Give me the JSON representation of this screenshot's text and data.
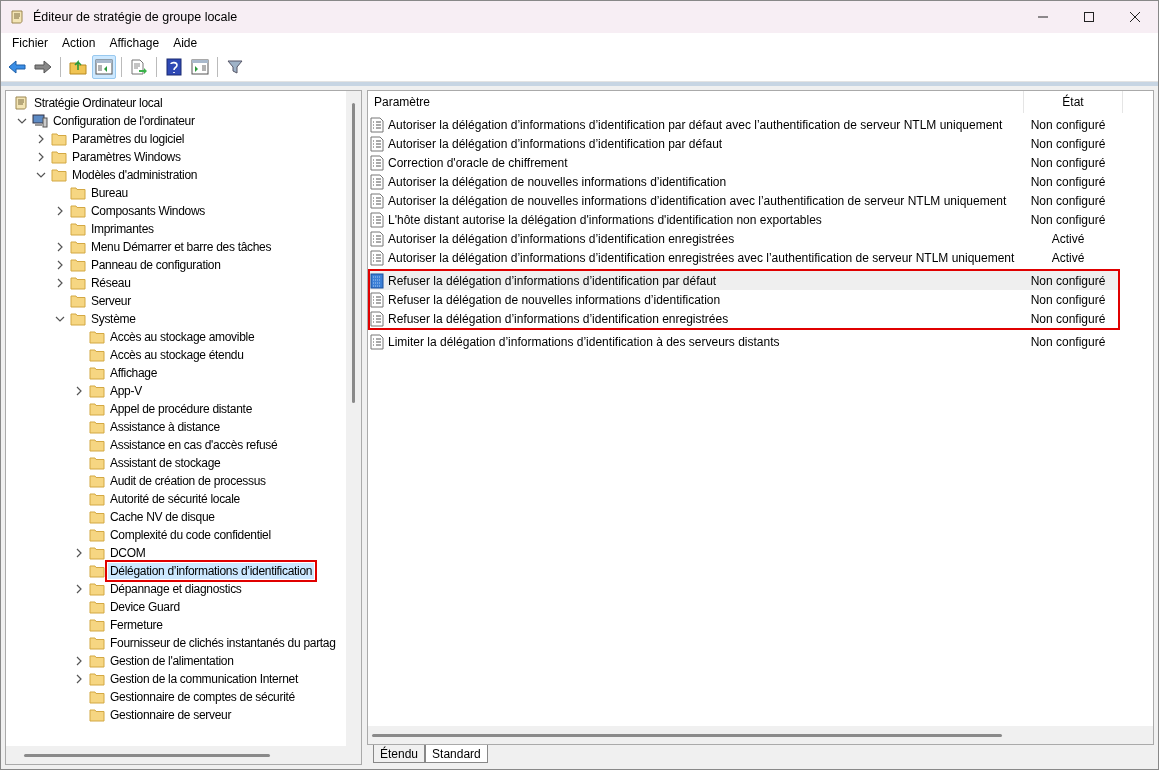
{
  "window": {
    "title": "Éditeur de stratégie de groupe locale"
  },
  "menu": [
    "Fichier",
    "Action",
    "Affichage",
    "Aide"
  ],
  "toolbar": [
    {
      "kind": "back",
      "pressed": false
    },
    {
      "kind": "forward",
      "pressed": false
    },
    {
      "kind": "up",
      "pressed": false
    },
    {
      "kind": "tree",
      "pressed": true
    },
    {
      "kind": "export",
      "pressed": false
    },
    {
      "kind": "help",
      "pressed": false
    },
    {
      "kind": "pane",
      "pressed": false
    },
    {
      "kind": "filter",
      "pressed": false
    }
  ],
  "tree": [
    {
      "label": "Stratégie Ordinateur local",
      "kind": "policy",
      "selected": false,
      "highlighted": false,
      "children": [
        {
          "label": "Configuration de l'ordinateur",
          "kind": "computer",
          "expanded": true,
          "selected": false,
          "highlighted": false,
          "children": [
            {
              "label": "Paramètres du logiciel",
              "kind": "folder",
              "expanded": false,
              "selected": false,
              "highlighted": false
            },
            {
              "label": "Paramètres Windows",
              "kind": "folder",
              "expanded": false,
              "selected": false,
              "highlighted": false
            },
            {
              "label": "Modèles d'administration",
              "kind": "folder",
              "expanded": true,
              "selected": false,
              "highlighted": false,
              "children": [
                {
                  "label": "Bureau",
                  "kind": "folder",
                  "selected": false,
                  "highlighted": false
                },
                {
                  "label": "Composants Windows",
                  "kind": "folder",
                  "expanded": false,
                  "selected": false,
                  "highlighted": false
                },
                {
                  "label": "Imprimantes",
                  "kind": "folder",
                  "selected": false,
                  "highlighted": false
                },
                {
                  "label": "Menu Démarrer et barre des tâches",
                  "kind": "folder",
                  "expanded": false,
                  "selected": false,
                  "highlighted": false
                },
                {
                  "label": "Panneau de configuration",
                  "kind": "folder",
                  "expanded": false,
                  "selected": false,
                  "highlighted": false
                },
                {
                  "label": "Réseau",
                  "kind": "folder",
                  "expanded": false,
                  "selected": false,
                  "highlighted": false
                },
                {
                  "label": "Serveur",
                  "kind": "folder",
                  "selected": false,
                  "highlighted": false
                },
                {
                  "label": "Système",
                  "kind": "folder",
                  "expanded": true,
                  "selected": false,
                  "highlighted": false,
                  "children": [
                    {
                      "label": "Accès au stockage amovible",
                      "kind": "folder",
                      "selected": false,
                      "highlighted": false
                    },
                    {
                      "label": "Accès au stockage étendu",
                      "kind": "folder",
                      "selected": false,
                      "highlighted": false
                    },
                    {
                      "label": "Affichage",
                      "kind": "folder",
                      "selected": false,
                      "highlighted": false
                    },
                    {
                      "label": "App-V",
                      "kind": "folder",
                      "expanded": false,
                      "selected": false,
                      "highlighted": false
                    },
                    {
                      "label": "Appel de procédure distante",
                      "kind": "folder",
                      "selected": false,
                      "highlighted": false
                    },
                    {
                      "label": "Assistance à distance",
                      "kind": "folder",
                      "selected": false,
                      "highlighted": false
                    },
                    {
                      "label": "Assistance en cas d'accès refusé",
                      "kind": "folder",
                      "selected": false,
                      "highlighted": false
                    },
                    {
                      "label": "Assistant de stockage",
                      "kind": "folder",
                      "selected": false,
                      "highlighted": false
                    },
                    {
                      "label": "Audit de création de processus",
                      "kind": "folder",
                      "selected": false,
                      "highlighted": false
                    },
                    {
                      "label": "Autorité de sécurité locale",
                      "kind": "folder",
                      "selected": false,
                      "highlighted": false
                    },
                    {
                      "label": "Cache NV de disque",
                      "kind": "folder",
                      "selected": false,
                      "highlighted": false
                    },
                    {
                      "label": "Complexité du code confidentiel",
                      "kind": "folder",
                      "selected": false,
                      "highlighted": false
                    },
                    {
                      "label": "DCOM",
                      "kind": "folder",
                      "expanded": false,
                      "selected": false,
                      "highlighted": false
                    },
                    {
                      "label": "Délégation d’informations d’identification",
                      "kind": "folder",
                      "selected": true,
                      "highlighted": true
                    },
                    {
                      "label": "Dépannage et diagnostics",
                      "kind": "folder",
                      "expanded": false,
                      "selected": false,
                      "highlighted": false
                    },
                    {
                      "label": "Device Guard",
                      "kind": "folder",
                      "selected": false,
                      "highlighted": false
                    },
                    {
                      "label": "Fermeture",
                      "kind": "folder",
                      "selected": false,
                      "highlighted": false
                    },
                    {
                      "label": "Fournisseur de clichés instantanés du partag",
                      "kind": "folder",
                      "selected": false,
                      "highlighted": false
                    },
                    {
                      "label": "Gestion de l'alimentation",
                      "kind": "folder",
                      "expanded": false,
                      "selected": false,
                      "highlighted": false
                    },
                    {
                      "label": "Gestion de la communication Internet",
                      "kind": "folder",
                      "expanded": false,
                      "selected": false,
                      "highlighted": false
                    },
                    {
                      "label": "Gestionnaire de comptes de sécurité",
                      "kind": "folder",
                      "selected": false,
                      "highlighted": false
                    },
                    {
                      "label": "Gestionnaire de serveur",
                      "kind": "folder",
                      "selected": false,
                      "highlighted": false
                    }
                  ]
                }
              ]
            }
          ]
        }
      ]
    }
  ],
  "table": {
    "columns": [
      "Paramètre",
      "État"
    ],
    "rows": [
      {
        "name": "Autoriser la délégation d’informations d’identification par défaut avec l’authentification de serveur NTLM uniquement",
        "state": "Non configuré",
        "selected": false,
        "highlighted": false
      },
      {
        "name": "Autoriser la délégation d’informations d’identification par défaut",
        "state": "Non configuré",
        "selected": false,
        "highlighted": false
      },
      {
        "name": "Correction d'oracle de chiffrement",
        "state": "Non configuré",
        "selected": false,
        "highlighted": false
      },
      {
        "name": "Autoriser la délégation de nouvelles informations d’identification",
        "state": "Non configuré",
        "selected": false,
        "highlighted": false
      },
      {
        "name": "Autoriser la délégation de nouvelles informations d’identification avec l’authentification de serveur NTLM uniquement",
        "state": "Non configuré",
        "selected": false,
        "highlighted": false
      },
      {
        "name": "L'hôte distant autorise la délégation d'informations d'identification non exportables",
        "state": "Non configuré",
        "selected": false,
        "highlighted": false
      },
      {
        "name": "Autoriser la délégation d’informations d’identification enregistrées",
        "state": "Activé",
        "selected": false,
        "highlighted": false
      },
      {
        "name": "Autoriser la délégation d’informations d’identification enregistrées avec l’authentification de serveur NTLM uniquement",
        "state": "Activé",
        "selected": false,
        "highlighted": false
      },
      {
        "name": "Refuser la délégation d’informations d’identification par défaut",
        "state": "Non configuré",
        "selected": true,
        "highlighted": true
      },
      {
        "name": "Refuser la délégation de nouvelles informations d’identification",
        "state": "Non configuré",
        "selected": false,
        "highlighted": true
      },
      {
        "name": "Refuser la délégation d’informations d’identification enregistrées",
        "state": "Non configuré",
        "selected": false,
        "highlighted": true
      },
      {
        "name": "Limiter la délégation d’informations d’identification à des serveurs distants",
        "state": "Non configuré",
        "selected": false,
        "highlighted": false
      }
    ]
  },
  "view_tabs": [
    {
      "label": "Étendu",
      "selected": false
    },
    {
      "label": "Standard",
      "selected": true
    }
  ]
}
